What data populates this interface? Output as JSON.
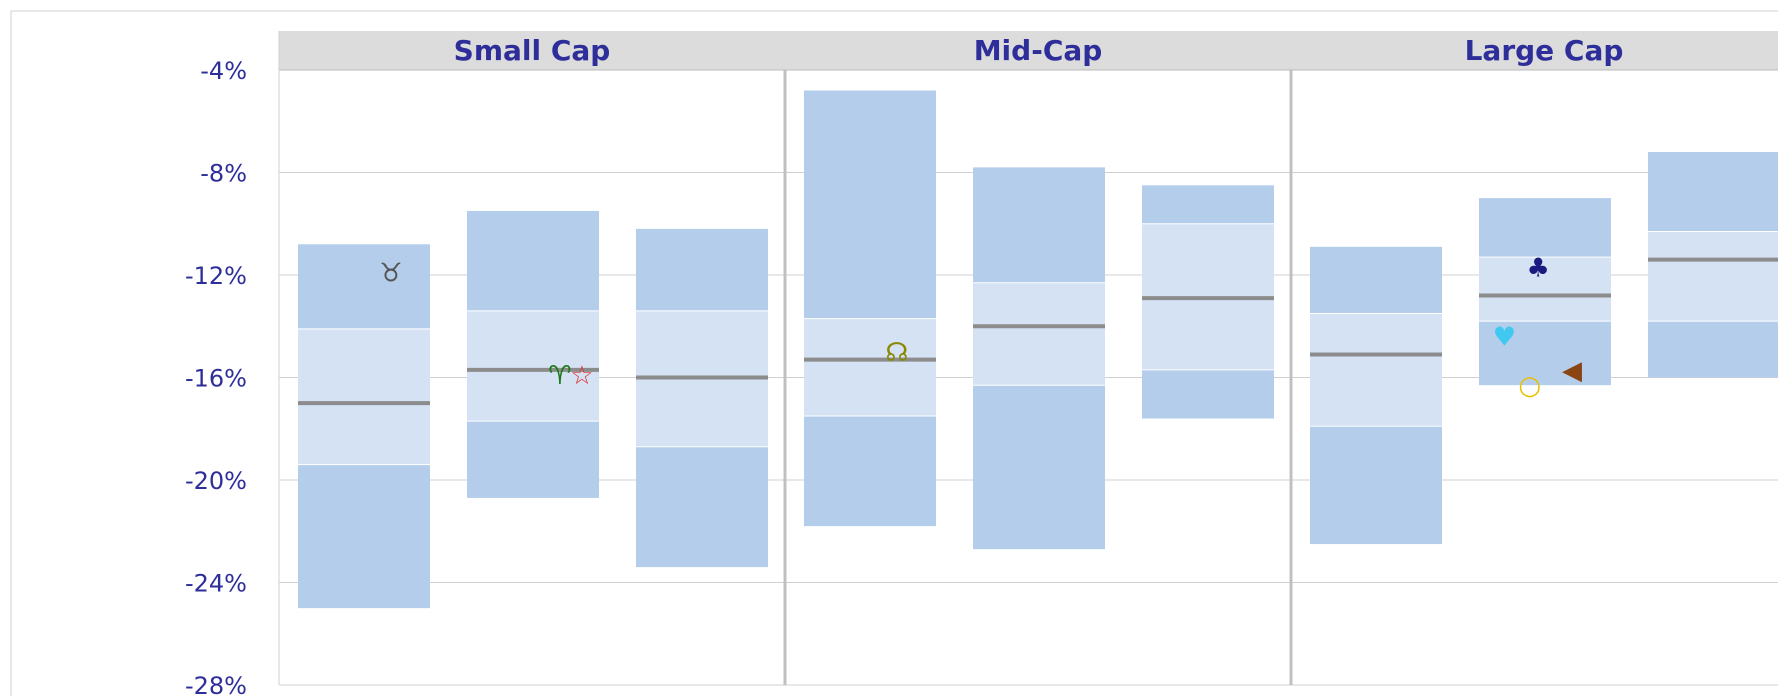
{
  "chart_data": {
    "type": "bar",
    "subtype": "floating-quartile-bars",
    "panels": [
      "Small Cap",
      "Mid-Cap",
      "Large Cap"
    ],
    "ylim": [
      -28,
      -4
    ],
    "yticks": [
      -4,
      -8,
      -12,
      -16,
      -20,
      -24,
      -28
    ],
    "ytick_labels": [
      "-4%",
      "-8%",
      "-12%",
      "-16%",
      "-20%",
      "-24%",
      "-28%"
    ],
    "grid": true,
    "colors": {
      "outer_band": "#b3cdeb",
      "inner_band": "#d4e2f3",
      "median_line": "#8c8c8c",
      "header_bg": "#dcdcdc",
      "text": "#2e2e9a",
      "grid": "#d0d0d0",
      "panel_divider": "#c0c0c0"
    },
    "boxes": [
      {
        "panel": 0,
        "slot": 0,
        "p95": -10.8,
        "p75": -14.1,
        "median": -17.0,
        "p25": -19.4,
        "p5": -25.0
      },
      {
        "panel": 0,
        "slot": 1,
        "p95": -9.5,
        "p75": -13.4,
        "median": -15.7,
        "p25": -17.7,
        "p5": -20.7
      },
      {
        "panel": 0,
        "slot": 2,
        "p95": -10.2,
        "p75": -13.4,
        "median": -16.0,
        "p25": -18.7,
        "p5": -23.4
      },
      {
        "panel": 1,
        "slot": 0,
        "p95": -4.8,
        "p75": -13.7,
        "median": -15.3,
        "p25": -17.5,
        "p5": -21.8
      },
      {
        "panel": 1,
        "slot": 1,
        "p95": -7.8,
        "p75": -12.3,
        "median": -14.0,
        "p25": -16.3,
        "p5": -22.7
      },
      {
        "panel": 1,
        "slot": 2,
        "p95": -8.5,
        "p75": -10.0,
        "median": -12.9,
        "p25": -15.7,
        "p5": -17.6
      },
      {
        "panel": 2,
        "slot": 0,
        "p95": -10.9,
        "p75": -13.5,
        "median": -15.1,
        "p25": -17.9,
        "p5": -22.5
      },
      {
        "panel": 2,
        "slot": 1,
        "p95": -9.0,
        "p75": -11.3,
        "median": -12.8,
        "p25": -13.8,
        "p5": -16.3
      },
      {
        "panel": 2,
        "slot": 2,
        "p95": -7.2,
        "p75": -10.3,
        "median": -11.4,
        "p25": -13.8,
        "p5": -16.0
      }
    ],
    "markers": [
      {
        "panel": 0,
        "slot": 0.55,
        "value": -11.9,
        "symbol": "♉",
        "color": "#555555",
        "name": "taurus-icon"
      },
      {
        "panel": 0,
        "slot": 1.55,
        "value": -15.9,
        "symbol": "♈",
        "color": "#1a7a1a",
        "name": "aries-icon"
      },
      {
        "panel": 0,
        "slot": 1.68,
        "value": -15.9,
        "symbol": "☆",
        "color": "#e03030",
        "name": "star-icon"
      },
      {
        "panel": 1,
        "slot": 0.55,
        "value": -15.0,
        "symbol": "☊",
        "color": "#8a8a00",
        "name": "ascending-node-icon"
      },
      {
        "panel": 2,
        "slot": 1.35,
        "value": -11.7,
        "symbol": "♣",
        "color": "#1a1a80",
        "name": "club-icon"
      },
      {
        "panel": 2,
        "slot": 1.15,
        "value": -14.4,
        "symbol": "♥",
        "color": "#40c8f0",
        "name": "heart-icon"
      },
      {
        "panel": 2,
        "slot": 1.55,
        "value": -15.7,
        "symbol": "◀",
        "color": "#8b4513",
        "name": "left-triangle-icon"
      },
      {
        "panel": 2,
        "slot": 1.3,
        "value": -16.3,
        "symbol": "○",
        "color": "#e8c000",
        "name": "circle-icon"
      }
    ]
  }
}
